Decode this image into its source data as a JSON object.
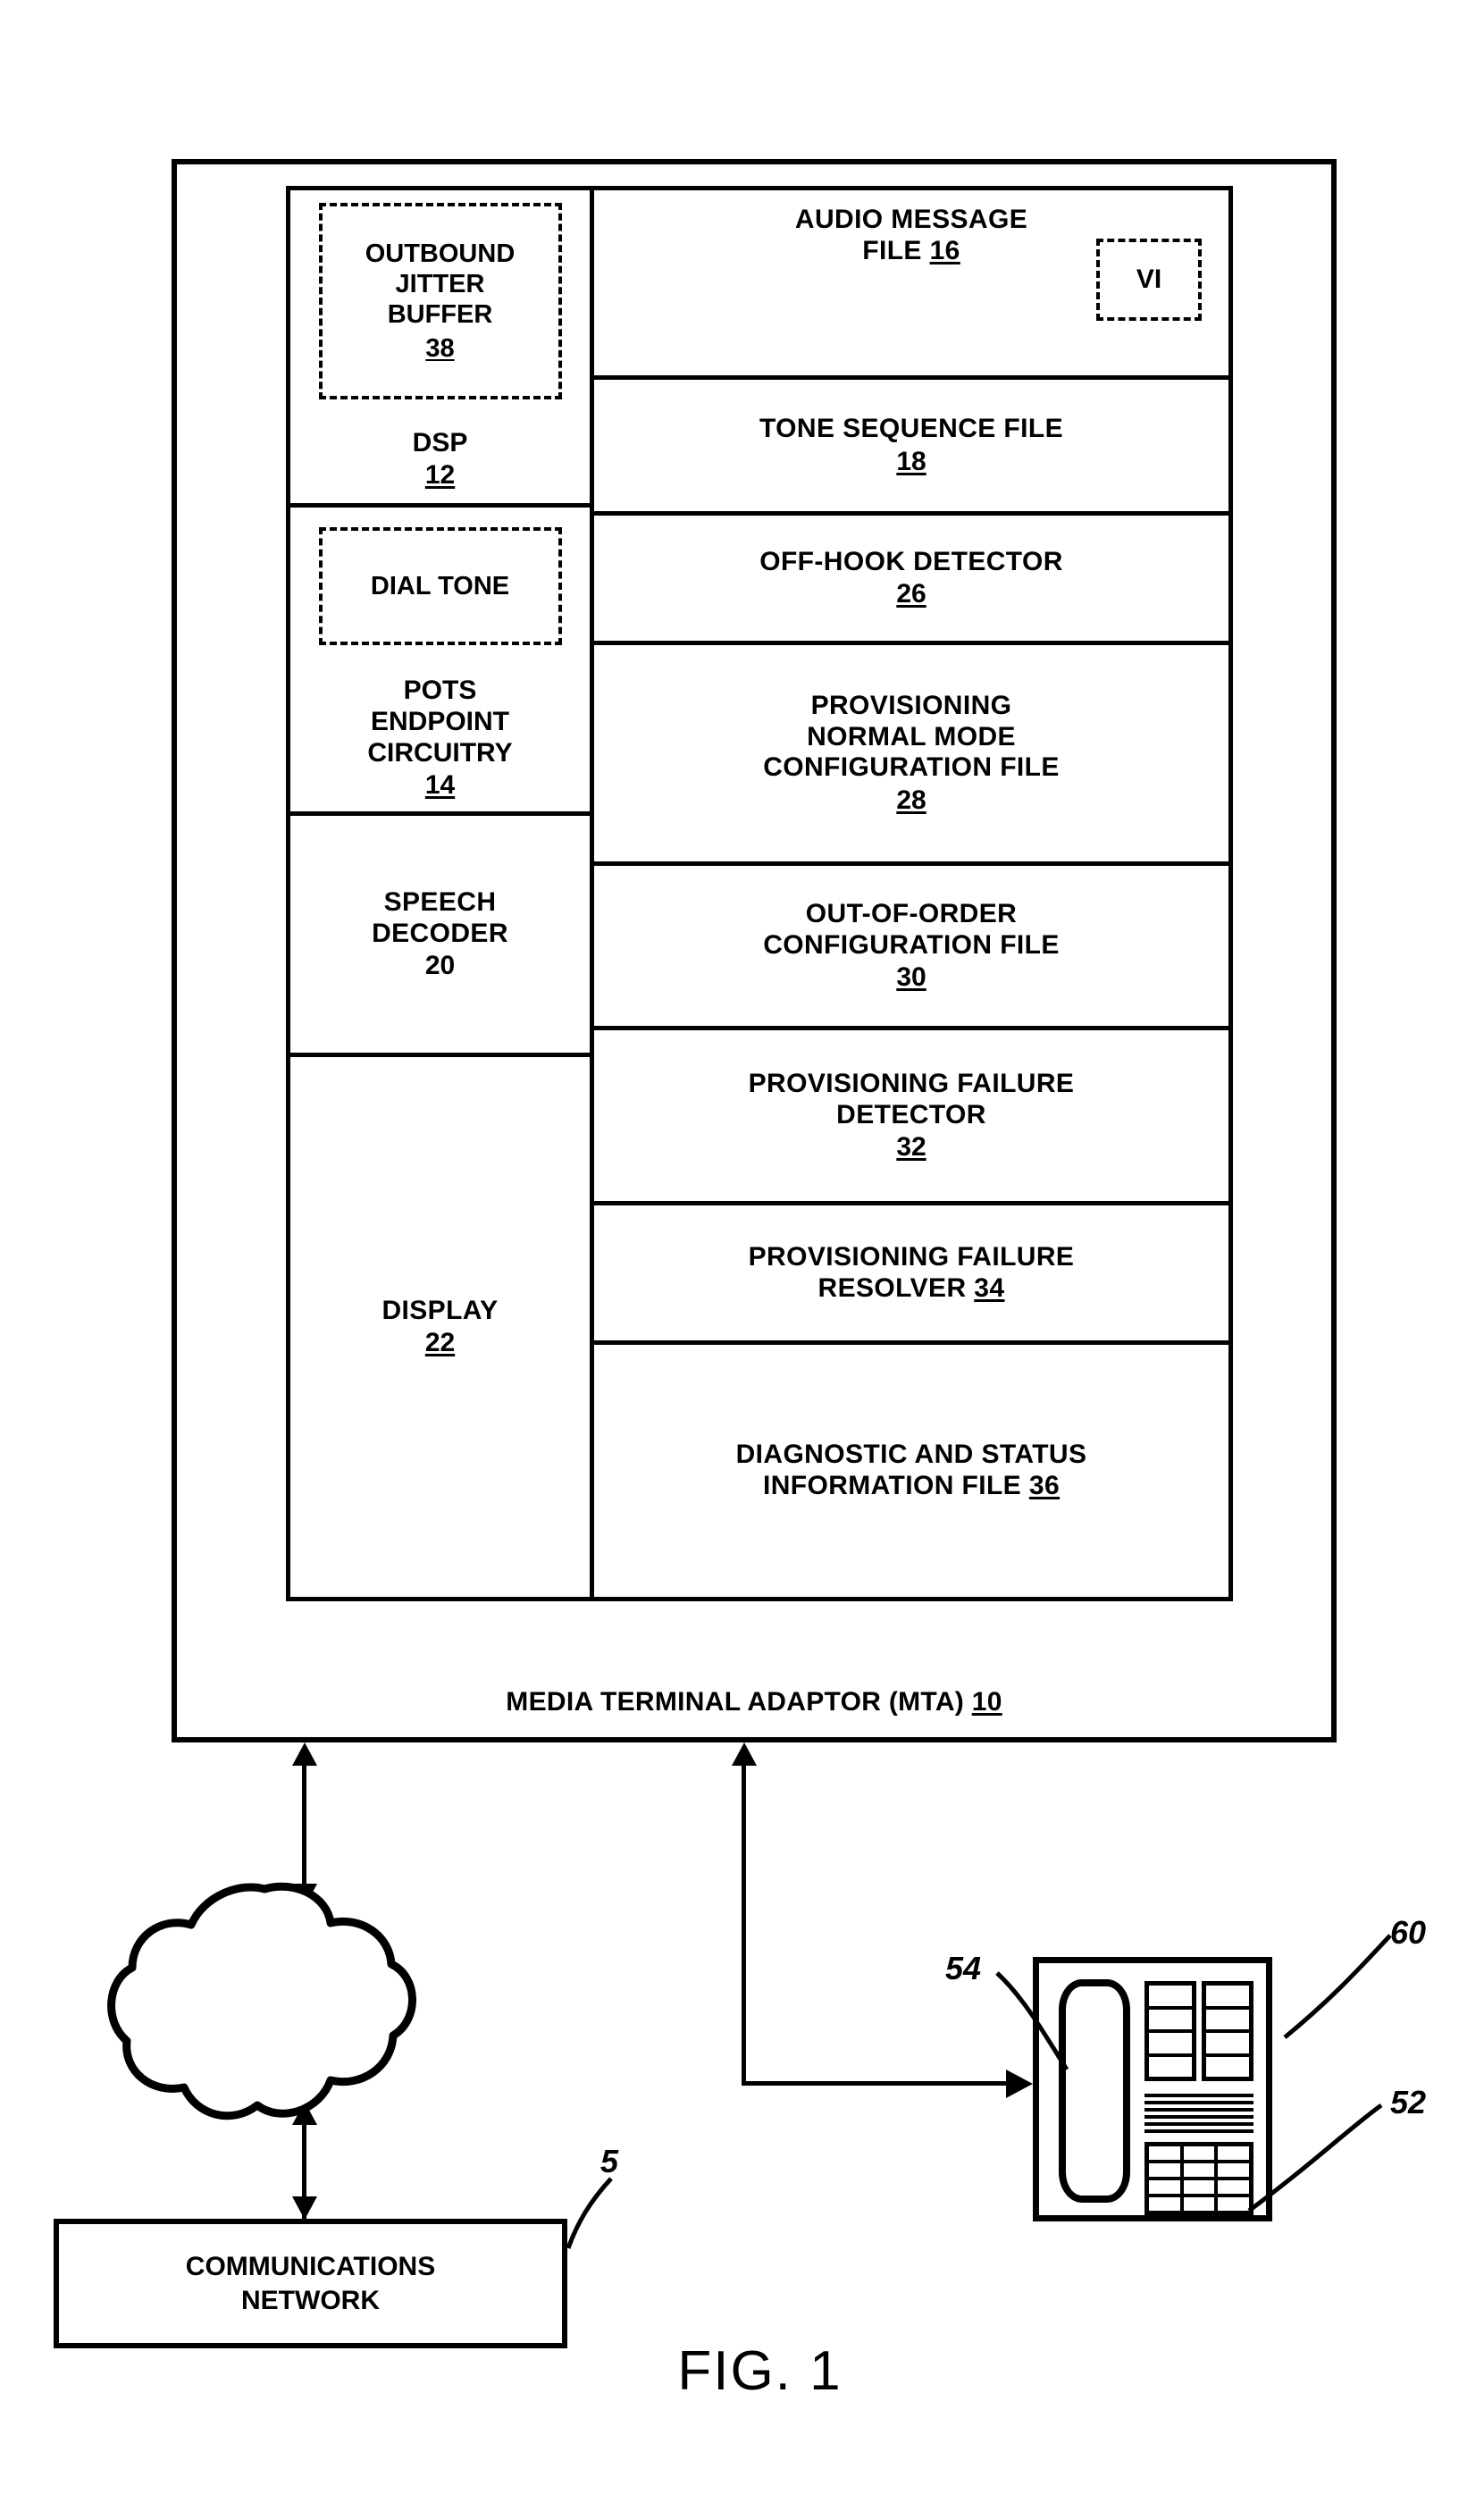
{
  "figure": {
    "caption": "FIG. 1",
    "mta_label": "MEDIA TERMINAL ADAPTOR (MTA)",
    "mta_ref": "10"
  },
  "left_column": {
    "dsp": {
      "dashed_block": {
        "line1": "OUTBOUND",
        "line2": "JITTER",
        "line3": "BUFFER",
        "ref": "38"
      },
      "label": "DSP",
      "ref": "12"
    },
    "pots": {
      "dashed_block": {
        "line1": "DIAL TONE"
      },
      "label_line1": "POTS",
      "label_line2": "ENDPOINT",
      "label_line3": "CIRCUITRY",
      "ref": "14"
    },
    "speech_decoder": {
      "label_line1": "SPEECH",
      "label_line2": "DECODER",
      "ref": "20"
    },
    "display": {
      "label": "DISPLAY",
      "ref": "22"
    }
  },
  "right_column": {
    "audio_message_file": {
      "line1": "AUDIO MESSAGE",
      "line2": "FILE",
      "ref": "16",
      "dashed_badge": "VI"
    },
    "tone_sequence_file": {
      "line1": "TONE SEQUENCE FILE",
      "ref": "18"
    },
    "off_hook_detector": {
      "line1": "OFF-HOOK DETECTOR",
      "ref": "26"
    },
    "provisioning_normal_mode": {
      "line1": "PROVISIONING",
      "line2": "NORMAL MODE",
      "line3": "CONFIGURATION FILE",
      "ref": "28"
    },
    "out_of_order_config": {
      "line1": "OUT-OF-ORDER",
      "line2": "CONFIGURATION FILE",
      "ref": "30"
    },
    "provisioning_failure_detector": {
      "line1": "PROVISIONING FAILURE",
      "line2": "DETECTOR",
      "ref": "32"
    },
    "provisioning_failure_resolver": {
      "line1": "PROVISIONING FAILURE",
      "line2": "RESOLVER",
      "ref": "34"
    },
    "diagnostic_status_file": {
      "line1": "DIAGNOSTIC AND STATUS",
      "line2": "INFORMATION FILE",
      "ref": "36"
    }
  },
  "bottom": {
    "communications_network": {
      "line1": "COMMUNICATIONS",
      "line2": "NETWORK",
      "ref": "5"
    },
    "telephone": {
      "handset_ref": "54",
      "body_ref": "60",
      "keypad_ref": "52"
    }
  },
  "colors": {
    "line": "#000000",
    "background": "#ffffff"
  }
}
